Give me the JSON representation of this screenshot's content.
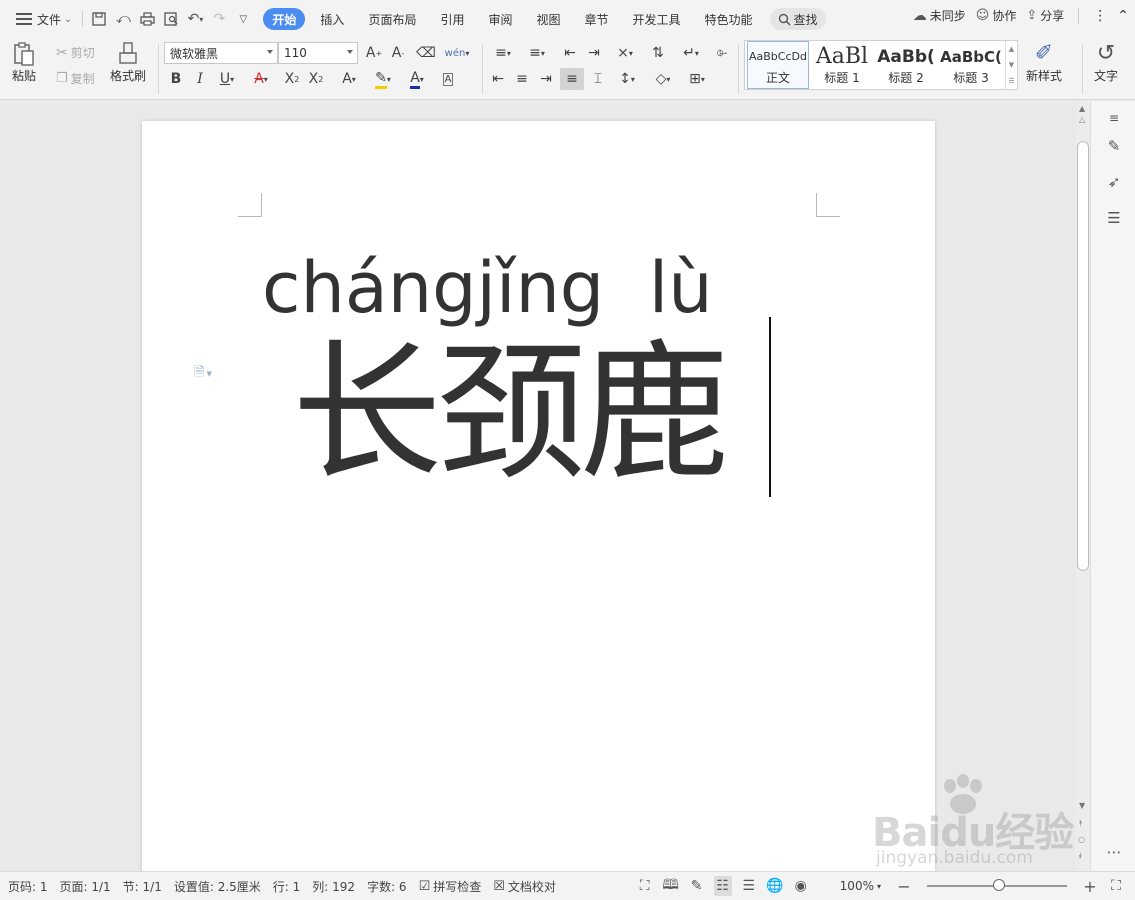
{
  "menu": {
    "file_label": "文件",
    "quick_icons": [
      "save-icon",
      "undo-history-icon",
      "print-icon",
      "print-preview-icon",
      "undo-icon",
      "redo-icon",
      "more-icon"
    ],
    "tabs": [
      {
        "label": "开始",
        "active": true
      },
      {
        "label": "插入",
        "active": false
      },
      {
        "label": "页面布局",
        "active": false
      },
      {
        "label": "引用",
        "active": false
      },
      {
        "label": "审阅",
        "active": false
      },
      {
        "label": "视图",
        "active": false
      },
      {
        "label": "章节",
        "active": false
      },
      {
        "label": "开发工具",
        "active": false
      },
      {
        "label": "特色功能",
        "active": false
      }
    ],
    "find_label": "查找",
    "sync_label": "未同步",
    "collab_label": "协作",
    "share_label": "分享",
    "accent_color": "#4a8cf0"
  },
  "ribbon": {
    "paste_label": "粘贴",
    "cut_label": "剪切",
    "copy_label": "复制",
    "format_painter_label": "格式刷",
    "font_name": "微软雅黑",
    "font_size": "110",
    "styles": [
      {
        "preview": "AaBbCcDd",
        "label": "正文",
        "current": true
      },
      {
        "preview": "AaBl",
        "label": "标题 1",
        "current": false
      },
      {
        "preview": "AaBb(",
        "label": "标题 2",
        "current": false
      },
      {
        "preview": "AaBbC(",
        "label": "标题 3",
        "current": false
      }
    ],
    "new_style_label": "新样式",
    "text_tools_label": "文字",
    "pinyin_guide_icon": "wén"
  },
  "document": {
    "pinyin": "chángjǐng  lù",
    "hanzi": "长颈鹿"
  },
  "status": {
    "page_no": "页码: 1",
    "pages": "页面: 1/1",
    "section": "节: 1/1",
    "setting_value": "设置值: 2.5厘米",
    "row": "行: 1",
    "column": "列: 192",
    "word_count": "字数: 6",
    "spell_check": "拼写检查",
    "doc_proof": "文档校对",
    "zoom": "100%"
  },
  "watermark": {
    "brand": "Baidu经验",
    "url": "jingyan.baidu.com"
  }
}
